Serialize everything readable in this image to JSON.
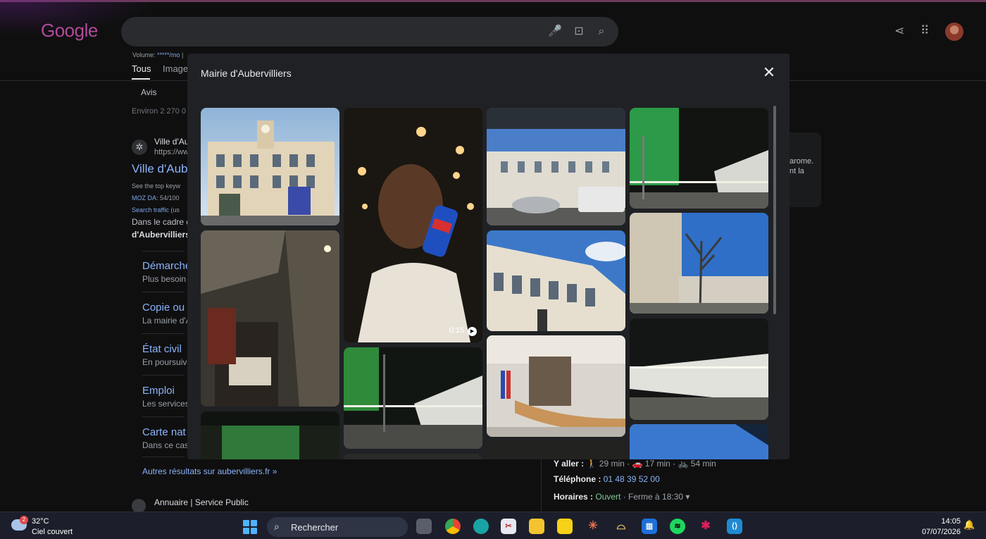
{
  "header": {
    "logo": "Google",
    "volume_prefix": "Volume: ",
    "volume_value": "*****/mo",
    "volume_rest": " | ",
    "tabs": [
      "Tous",
      "Image"
    ],
    "subtab": "Avis",
    "results_count": "Environ 2 270 0"
  },
  "result": {
    "site_name": "Ville d'Au",
    "site_url": "https://ww",
    "title": "Ville d'Aube",
    "meta1": "See the top keyw",
    "moz_label": "MOZ DA: ",
    "moz_value": "54/100",
    "search_traffic": "Search traffic",
    "search_traffic_rest": " (us",
    "snippet1": "Dans le cadre d",
    "snippet2": "d'Aubervilliers",
    "sublinks": [
      {
        "title": "Démarche",
        "desc": "Plus besoin"
      },
      {
        "title": "Copie ou",
        "desc": "La mairie d'A"
      },
      {
        "title": "État civil",
        "desc": "En poursuiva"
      },
      {
        "title": "Emploi",
        "desc": "Les services"
      },
      {
        "title": "Carte nat",
        "desc": "Dans ce cas"
      }
    ],
    "more_link": "Autres résultats sur aubervilliers.fr »",
    "annuaire": "Annuaire | Service Public"
  },
  "knowledge_panel": {
    "frag1": "arome.",
    "frag2": "nt la",
    "goto_label": "Y aller : ",
    "goto_walk": "29 min",
    "goto_car": "17 min",
    "goto_bike": "54 min",
    "phone_label": "Téléphone : ",
    "phone": "01 48 39 52 00",
    "hours_label": "Horaires : ",
    "hours_status": "Ouvert",
    "hours_rest": " · Ferme à 18:30 ▾"
  },
  "modal": {
    "title": "Mairie d'Aubervilliers",
    "video_duration": "0:15"
  },
  "taskbar": {
    "weather_badge": "2",
    "weather_temp": "32°C",
    "weather_desc": "Ciel couvert",
    "search_label": "Rechercher",
    "time": "14:05",
    "date": "07/07/2026"
  }
}
